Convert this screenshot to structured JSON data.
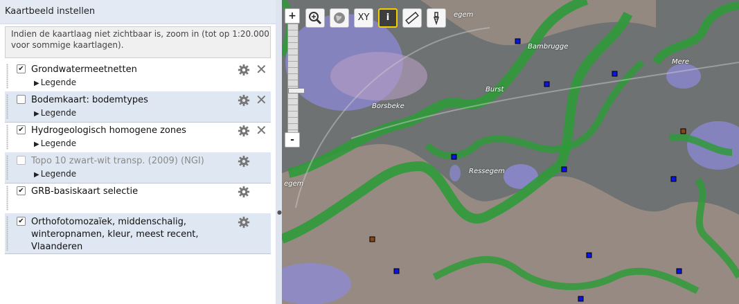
{
  "panel": {
    "title": "Kaartbeeld instellen",
    "notice": "Indien de kaartlaag niet zichtbaar is, zoom in (tot op 1:20.000 voor sommige kaartlagen).",
    "layers": [
      {
        "name": "Grondwatermeetnetten",
        "checked": true,
        "legend": "Legende"
      },
      {
        "name": "Bodemkaart: bodemtypes",
        "checked": false,
        "legend": "Legende"
      },
      {
        "name": "Hydrogeologisch homogene zones",
        "checked": true,
        "legend": "Legende"
      },
      {
        "name": "Topo 10 zwart-wit transp. (2009) (NGI)",
        "checked": false,
        "legend": "Legende"
      },
      {
        "name": "GRB-basiskaart selectie",
        "checked": true
      },
      {
        "name": "Orthofotomozaïek, middenschalig, winteropnamen, kleur, meest recent, Vlaanderen",
        "checked": true
      }
    ]
  },
  "map": {
    "zoom_in": "+",
    "zoom_out": "-",
    "tools": {
      "xy": "XY",
      "info": "i"
    },
    "labels": [
      "Bambrugge",
      "Burst",
      "Borsbeke",
      "Ressegem",
      "Mere",
      "egem",
      "egem"
    ],
    "colors": {
      "zone_green": "#2f9a3a",
      "zone_purple": "#8e89d8",
      "zone_tan": "#d9b79c",
      "marker_blue": "#0a14e6",
      "marker_brown": "#8b4513"
    }
  }
}
